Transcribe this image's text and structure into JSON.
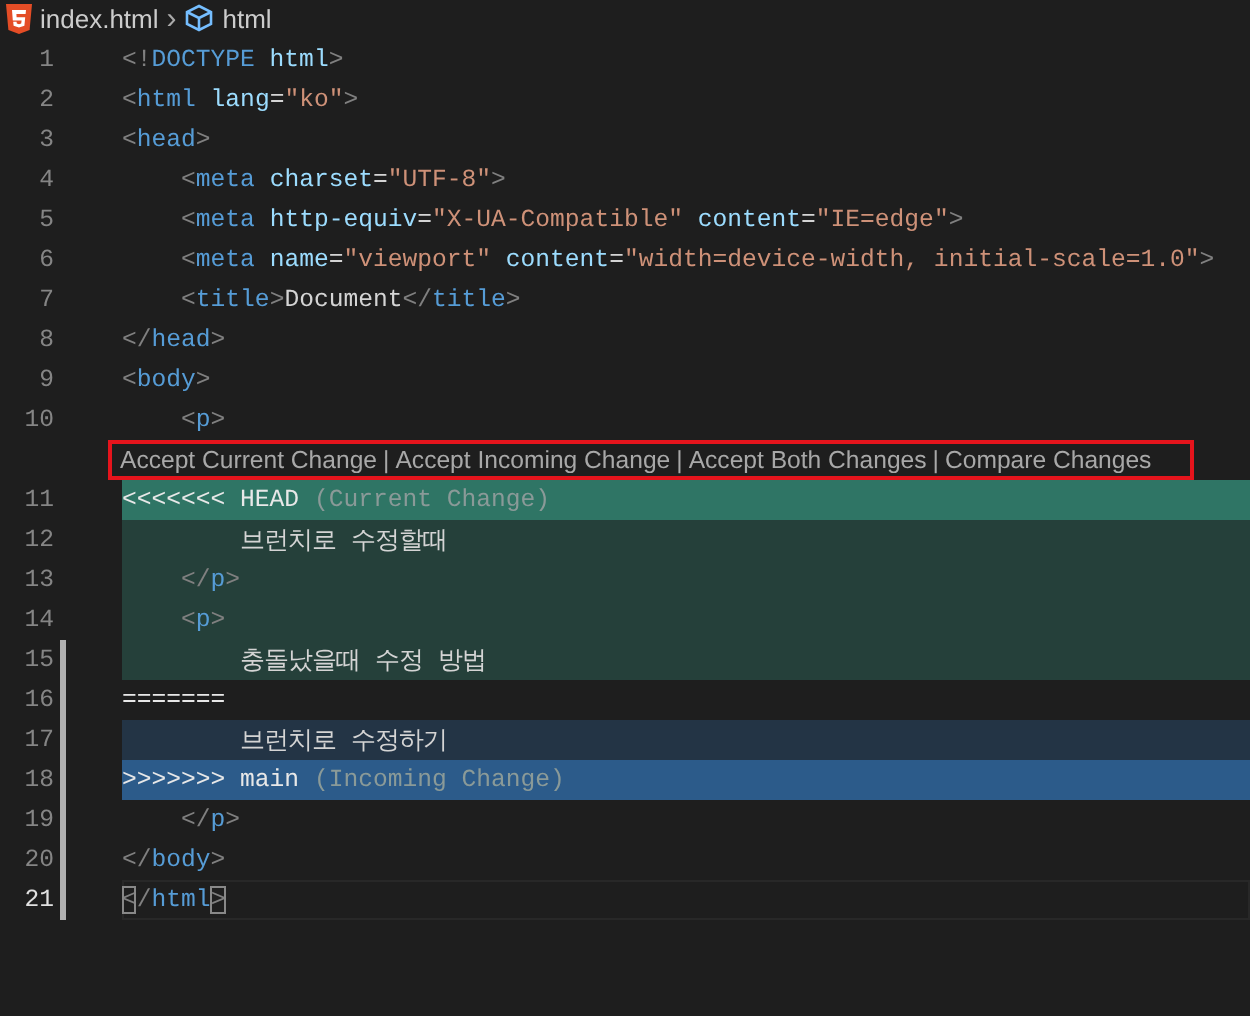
{
  "breadcrumb": {
    "file": "index.html",
    "separator": "›",
    "symbol": "html"
  },
  "lines": [
    {
      "number": "1",
      "kind": "none",
      "gutter": false,
      "current": false,
      "tokens": [
        {
          "kind": "punct",
          "text": "<!"
        },
        {
          "kind": "tag",
          "text": "DOCTYPE"
        },
        {
          "kind": "attr",
          "text": " html"
        },
        {
          "kind": "punct",
          "text": ">"
        }
      ]
    },
    {
      "number": "2",
      "kind": "none",
      "gutter": false,
      "current": false,
      "tokens": [
        {
          "kind": "punct",
          "text": "<"
        },
        {
          "kind": "tag",
          "text": "html"
        },
        {
          "kind": "attr",
          "text": " lang"
        },
        {
          "kind": "text",
          "text": "="
        },
        {
          "kind": "string",
          "text": "\"ko\""
        },
        {
          "kind": "punct",
          "text": ">"
        }
      ]
    },
    {
      "number": "3",
      "kind": "none",
      "gutter": false,
      "current": false,
      "tokens": [
        {
          "kind": "punct",
          "text": "<"
        },
        {
          "kind": "tag",
          "text": "head"
        },
        {
          "kind": "punct",
          "text": ">"
        }
      ]
    },
    {
      "number": "4",
      "kind": "none",
      "gutter": false,
      "current": false,
      "tokens": [
        {
          "kind": "punct",
          "text": "    <"
        },
        {
          "kind": "tag",
          "text": "meta"
        },
        {
          "kind": "attr",
          "text": " charset"
        },
        {
          "kind": "text",
          "text": "="
        },
        {
          "kind": "string",
          "text": "\"UTF-8\""
        },
        {
          "kind": "punct",
          "text": ">"
        }
      ]
    },
    {
      "number": "5",
      "kind": "none",
      "gutter": false,
      "current": false,
      "tokens": [
        {
          "kind": "punct",
          "text": "    <"
        },
        {
          "kind": "tag",
          "text": "meta"
        },
        {
          "kind": "attr",
          "text": " http-equiv"
        },
        {
          "kind": "text",
          "text": "="
        },
        {
          "kind": "string",
          "text": "\"X-UA-Compatible\""
        },
        {
          "kind": "attr",
          "text": " content"
        },
        {
          "kind": "text",
          "text": "="
        },
        {
          "kind": "string",
          "text": "\"IE=edge\""
        },
        {
          "kind": "punct",
          "text": ">"
        }
      ]
    },
    {
      "number": "6",
      "kind": "none",
      "gutter": false,
      "current": false,
      "tokens": [
        {
          "kind": "punct",
          "text": "    <"
        },
        {
          "kind": "tag",
          "text": "meta"
        },
        {
          "kind": "attr",
          "text": " name"
        },
        {
          "kind": "text",
          "text": "="
        },
        {
          "kind": "string",
          "text": "\"viewport\""
        },
        {
          "kind": "attr",
          "text": " content"
        },
        {
          "kind": "text",
          "text": "="
        },
        {
          "kind": "string",
          "text": "\"width=device-width, initial-scale=1.0\""
        },
        {
          "kind": "punct",
          "text": ">"
        }
      ]
    },
    {
      "number": "7",
      "kind": "none",
      "gutter": false,
      "current": false,
      "tokens": [
        {
          "kind": "punct",
          "text": "    <"
        },
        {
          "kind": "tag",
          "text": "title"
        },
        {
          "kind": "punct",
          "text": ">"
        },
        {
          "kind": "text",
          "text": "Document"
        },
        {
          "kind": "punct",
          "text": "</"
        },
        {
          "kind": "tag",
          "text": "title"
        },
        {
          "kind": "punct",
          "text": ">"
        }
      ]
    },
    {
      "number": "8",
      "kind": "none",
      "gutter": false,
      "current": false,
      "tokens": [
        {
          "kind": "punct",
          "text": "</"
        },
        {
          "kind": "tag",
          "text": "head"
        },
        {
          "kind": "punct",
          "text": ">"
        }
      ]
    },
    {
      "number": "9",
      "kind": "none",
      "gutter": false,
      "current": false,
      "tokens": [
        {
          "kind": "punct",
          "text": "<"
        },
        {
          "kind": "tag",
          "text": "body"
        },
        {
          "kind": "punct",
          "text": ">"
        }
      ]
    },
    {
      "number": "10",
      "kind": "none",
      "gutter": false,
      "current": false,
      "tokens": [
        {
          "kind": "punct",
          "text": "    <"
        },
        {
          "kind": "tag",
          "text": "p"
        },
        {
          "kind": "punct",
          "text": ">"
        }
      ],
      "codelens": {
        "outlined": true,
        "separator": "|",
        "actions": [
          "Accept Current Change",
          "Accept Incoming Change",
          "Accept Both Changes",
          "Compare Changes"
        ]
      }
    },
    {
      "number": "11",
      "kind": "current-header",
      "gutter": false,
      "current": false,
      "tokens": [
        {
          "kind": "marker",
          "text": "<<<<<<< HEAD"
        },
        {
          "kind": "comment",
          "text": " (Current Change)"
        }
      ]
    },
    {
      "number": "12",
      "kind": "current",
      "gutter": false,
      "current": false,
      "tokens": [
        {
          "kind": "text",
          "text": "        브런치로 수정할때"
        }
      ]
    },
    {
      "number": "13",
      "kind": "current",
      "gutter": false,
      "current": false,
      "tokens": [
        {
          "kind": "punct",
          "text": "    </"
        },
        {
          "kind": "tag",
          "text": "p"
        },
        {
          "kind": "punct",
          "text": ">"
        }
      ]
    },
    {
      "number": "14",
      "kind": "current",
      "gutter": false,
      "current": false,
      "tokens": [
        {
          "kind": "punct",
          "text": "    <"
        },
        {
          "kind": "tag",
          "text": "p"
        },
        {
          "kind": "punct",
          "text": ">"
        }
      ]
    },
    {
      "number": "15",
      "kind": "current",
      "gutter": true,
      "current": false,
      "tokens": [
        {
          "kind": "text",
          "text": "        충돌났을때 수정 방법"
        }
      ]
    },
    {
      "number": "16",
      "kind": "none",
      "gutter": true,
      "current": false,
      "tokens": [
        {
          "kind": "marker",
          "text": "======="
        }
      ]
    },
    {
      "number": "17",
      "kind": "incoming",
      "gutter": true,
      "current": false,
      "tokens": [
        {
          "kind": "text",
          "text": "        브런치로 수정하기"
        }
      ]
    },
    {
      "number": "18",
      "kind": "incoming-header",
      "gutter": true,
      "current": false,
      "tokens": [
        {
          "kind": "marker",
          "text": ">>>>>>> main"
        },
        {
          "kind": "comment",
          "text": " (Incoming Change)"
        }
      ]
    },
    {
      "number": "19",
      "kind": "none",
      "gutter": true,
      "current": false,
      "tokens": [
        {
          "kind": "punct",
          "text": "    </"
        },
        {
          "kind": "tag",
          "text": "p"
        },
        {
          "kind": "punct",
          "text": ">"
        }
      ]
    },
    {
      "number": "20",
      "kind": "none",
      "gutter": true,
      "current": false,
      "tokens": [
        {
          "kind": "punct",
          "text": "</"
        },
        {
          "kind": "tag",
          "text": "body"
        },
        {
          "kind": "punct",
          "text": ">"
        }
      ]
    },
    {
      "number": "21",
      "kind": "none",
      "gutter": true,
      "current": true,
      "tokens": [
        {
          "kind": "bracket",
          "text": "<"
        },
        {
          "kind": "punct",
          "text": "/"
        },
        {
          "kind": "tag",
          "text": "html"
        },
        {
          "kind": "bracket",
          "text": ">"
        }
      ]
    }
  ]
}
